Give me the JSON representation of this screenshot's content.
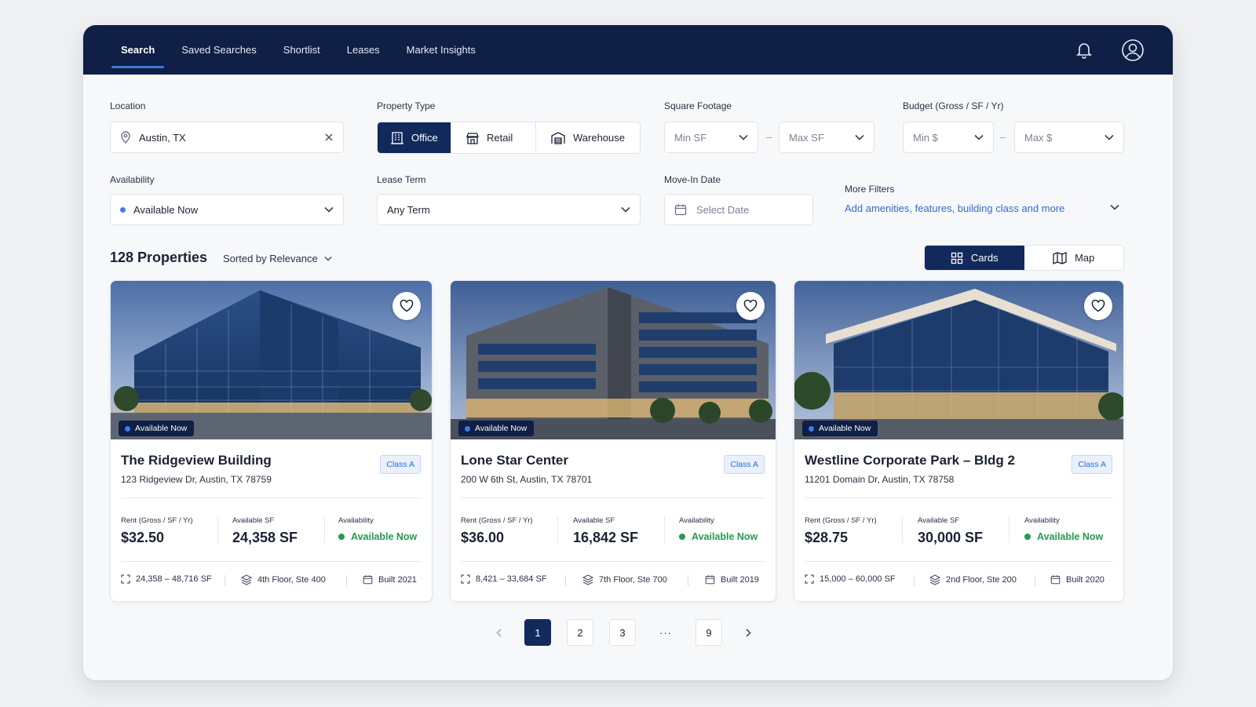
{
  "nav": {
    "items": [
      "Search",
      "Saved Searches",
      "Shortlist",
      "Leases",
      "Market Insights"
    ]
  },
  "filters": {
    "location": {
      "label": "Location",
      "value": "Austin, TX"
    },
    "property_type": {
      "label": "Property Type",
      "options": [
        "Office",
        "Retail",
        "Warehouse"
      ],
      "selected": "Office"
    },
    "square_footage": {
      "label": "Square Footage",
      "min_placeholder": "Min SF",
      "max_placeholder": "Max SF",
      "separator": "–"
    },
    "budget": {
      "label": "Budget (Gross / SF / Yr)",
      "min_placeholder": "Min $",
      "max_placeholder": "Max $",
      "separator": "–"
    },
    "availability": {
      "label": "Availability",
      "value": "Available Now"
    },
    "lease_term": {
      "label": "Lease Term",
      "value": "Any Term"
    },
    "move_in": {
      "label": "Move-In Date",
      "placeholder": "Select Date"
    },
    "more": {
      "label": "More Filters",
      "link": "Add amenities, features, building class and more"
    }
  },
  "results": {
    "count": "128 Properties",
    "sort": "Sorted by Relevance",
    "views": [
      "Cards",
      "Map"
    ],
    "active_view": "Cards"
  },
  "cards": [
    {
      "status": "Available Now",
      "title": "The Ridgeview Building",
      "address": "123 Ridgeview Dr, Austin, TX 78759",
      "class": "Class A",
      "rent_label": "Rent (Gross / SF / Yr)",
      "rent": "$32.50",
      "sf_label": "Available SF",
      "sf": "24,358 SF",
      "avail_label": "Availability",
      "avail": "Available Now",
      "range": "24,358 – 48,716 SF",
      "floor": "4th Floor, Ste 400",
      "built": "Built 2021"
    },
    {
      "status": "Available Now",
      "title": "Lone Star Center",
      "address": "200 W 6th St, Austin, TX 78701",
      "class": "Class A",
      "rent_label": "Rent (Gross / SF / Yr)",
      "rent": "$36.00",
      "sf_label": "Available SF",
      "sf": "16,842 SF",
      "avail_label": "Availability",
      "avail": "Available Now",
      "range": "8,421 – 33,684 SF",
      "floor": "7th Floor, Ste 700",
      "built": "Built 2019"
    },
    {
      "status": "Available Now",
      "title": "Westline Corporate Park – Bldg 2",
      "address": "11201 Domain Dr, Austin, TX 78758",
      "class": "Class A",
      "rent_label": "Rent (Gross / SF / Yr)",
      "rent": "$28.75",
      "sf_label": "Available SF",
      "sf": "30,000 SF",
      "avail_label": "Availability",
      "avail": "Available Now",
      "range": "15,000 – 60,000 SF",
      "floor": "2nd Floor, Ste 200",
      "built": "Built 2020"
    }
  ],
  "pagination": {
    "pages": [
      "1",
      "2",
      "3",
      "···",
      "9"
    ],
    "current": "1"
  },
  "icons": {
    "bell": "bell-icon",
    "user": "user-circle-icon",
    "pin": "map-pin-icon",
    "clear": "close-icon",
    "office": "office-building-icon",
    "retail": "storefront-icon",
    "warehouse": "warehouse-icon",
    "calendar": "calendar-icon",
    "grid": "grid-icon",
    "map": "map-icon",
    "heart": "heart-icon"
  },
  "colors": {
    "nav_bg": "#0f1f45",
    "primary": "#12295c",
    "accent": "#2f6cd6",
    "success": "#1f9d4e"
  }
}
